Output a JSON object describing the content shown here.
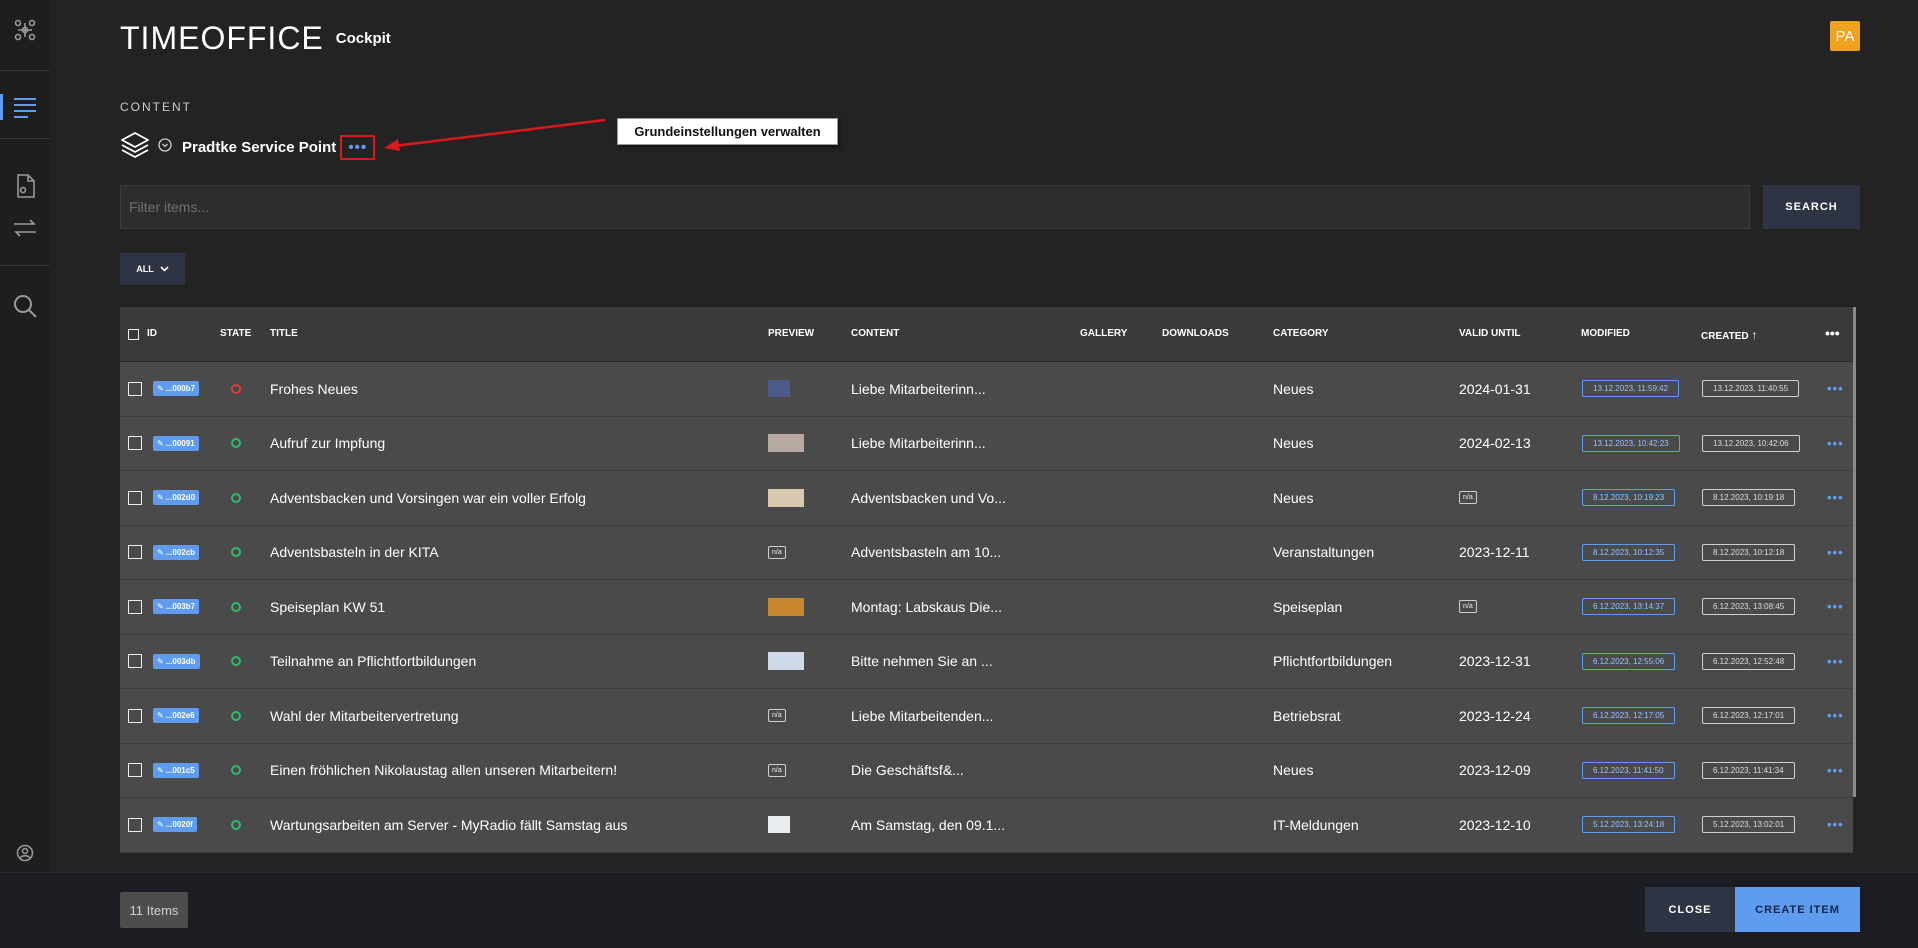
{
  "header": {
    "logo_text": "TIMEOFFICE",
    "logo_sub": "Cockpit",
    "avatar_initials": "PA",
    "avatar_color": "#f0a11e"
  },
  "page": {
    "section_label": "CONTENT",
    "title": "Pradtke Service Point",
    "more_button": "•••",
    "callout": "Grundeinstellungen verwalten"
  },
  "search": {
    "placeholder": "Filter items...",
    "button_label": "SEARCH"
  },
  "filter_dropdown": {
    "selected": "ALL"
  },
  "table": {
    "headers": {
      "id": "ID",
      "state": "STATE",
      "title": "TITLE",
      "preview": "PREVIEW",
      "content": "CONTENT",
      "gallery": "GALLERY",
      "downloads": "DOWNLOADS",
      "category": "CATEGORY",
      "valid_until": "VALID UNTIL",
      "modified": "MODIFIED",
      "created": "CREATED",
      "created_sort_icon": "↑",
      "more": "•••"
    },
    "rows": [
      {
        "id": "...000b7",
        "state": "inactive",
        "title": "Frohes Neues",
        "preview": "image",
        "content": "Liebe Mitarbeiterinn...",
        "category": "Neues",
        "valid_until": "2024-01-31",
        "modified": "13.12.2023, 11:59:42",
        "created": "13.12.2023, 11:40:55"
      },
      {
        "id": "...00091",
        "state": "active",
        "title": "Aufruf zur Impfung",
        "preview": "image",
        "content": "Liebe Mitarbeiterinn...",
        "category": "Neues",
        "valid_until": "2024-02-13",
        "modified": "13.12.2023, 10:42:23",
        "created": "13.12.2023, 10:42:06"
      },
      {
        "id": "...002d0",
        "state": "active",
        "title": "Adventsbacken und Vorsingen war ein voller Erfolg",
        "preview": "image",
        "content": "Adventsbacken und Vo...",
        "category": "Neues",
        "valid_until": "n/a",
        "modified": "8.12.2023, 10:19:23",
        "created": "8.12.2023, 10:19:18"
      },
      {
        "id": "...002cb",
        "state": "active",
        "title": "Adventsbasteln in der KITA",
        "preview": "n/a",
        "content": "Adventsbasteln am 10...",
        "category": "Veranstaltungen",
        "valid_until": "2023-12-11",
        "modified": "8.12.2023, 10:12:35",
        "created": "8.12.2023, 10:12:18"
      },
      {
        "id": "...003b7",
        "state": "active",
        "title": "Speiseplan KW 51",
        "preview": "image",
        "content": "Montag: Labskaus Die...",
        "category": "Speiseplan",
        "valid_until": "n/a",
        "modified": "6.12.2023, 13:14:37",
        "created": "6.12.2023, 13:08:45"
      },
      {
        "id": "...003db",
        "state": "active",
        "title": "Teilnahme an Pflichtfortbildungen",
        "preview": "image",
        "content": "Bitte nehmen Sie an ...",
        "category": "Pflichtfortbildungen",
        "valid_until": "2023-12-31",
        "modified": "6.12.2023, 12:55:06",
        "created": "6.12.2023, 12:52:48"
      },
      {
        "id": "...002e6",
        "state": "active",
        "title": "Wahl der Mitarbeitervertretung",
        "preview": "n/a",
        "content": "Liebe Mitarbeitenden...",
        "category": "Betriebsrat",
        "valid_until": "2023-12-24",
        "modified": "6.12.2023, 12:17:05",
        "created": "6.12.2023, 12:17:01"
      },
      {
        "id": "...001c5",
        "state": "active",
        "title": "Einen fröhlichen Nikolaustag allen unseren Mitarbeitern!",
        "preview": "n/a",
        "content": "Die Geschäftsf&...",
        "category": "Neues",
        "valid_until": "2023-12-09",
        "modified": "6.12.2023, 11:41:50",
        "created": "6.12.2023, 11:41:34"
      },
      {
        "id": "...0020f",
        "state": "active",
        "title": "Wartungsarbeiten am Server - MyRadio fällt Samstag aus",
        "preview": "image",
        "content": "Am Samstag, den 09.1...",
        "category": "IT-Meldungen",
        "valid_until": "2023-12-10",
        "modified": "5.12.2023, 13:24:18",
        "created": "5.12.2023, 13:02:01"
      }
    ],
    "row_more": "•••"
  },
  "footer": {
    "count": "11 Items",
    "close_label": "CLOSE",
    "create_label": "CREATE ITEM"
  },
  "colors": {
    "accent": "#5f9cf0",
    "state_active": "#2fbb6e",
    "state_inactive": "#e13b3b",
    "highlight_box": "#d9191e"
  },
  "icons": {
    "sidebar": [
      "nodes-icon",
      "content-list-icon",
      "document-icon",
      "sync-arrows-icon",
      "search-icon",
      "account-icon",
      "settings-sliders-icon",
      "users-icon"
    ],
    "crumb": [
      "layers-icon",
      "chevron-circle-icon"
    ]
  }
}
